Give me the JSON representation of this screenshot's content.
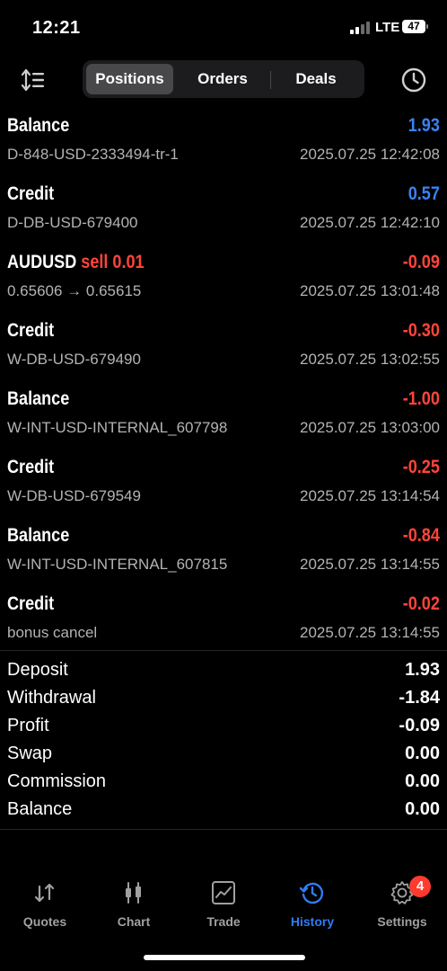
{
  "status_bar": {
    "time": "12:21",
    "network": "LTE",
    "battery": "47"
  },
  "toolbar": {
    "tabs": [
      {
        "label": "Positions"
      },
      {
        "label": "Orders"
      },
      {
        "label": "Deals"
      }
    ],
    "active_tab": "Positions",
    "sort_icon": "sort-icon",
    "history_icon": "clock-icon"
  },
  "colors": {
    "positive": "#3b82f6",
    "negative": "#ff453a",
    "active_tab": "#2f7bf5",
    "badge": "#ff3b30"
  },
  "history": [
    {
      "title": "Balance",
      "amount": "1.93",
      "sign": "positive",
      "subtitle": "D-848-USD-2333494-tr-1",
      "datetime": "2025.07.25 12:42:08"
    },
    {
      "title": "Credit",
      "amount": "0.57",
      "sign": "positive",
      "subtitle": "D-DB-USD-679400",
      "datetime": "2025.07.25 12:42:10"
    },
    {
      "title": "AUDUSD",
      "trade": "sell 0.01",
      "amount": "-0.09",
      "sign": "negative",
      "subtitle": "0.65606 → 0.65615",
      "datetime": "2025.07.25 13:01:48"
    },
    {
      "title": "Credit",
      "amount": "-0.30",
      "sign": "negative",
      "subtitle": "W-DB-USD-679490",
      "datetime": "2025.07.25 13:02:55"
    },
    {
      "title": "Balance",
      "amount": "-1.00",
      "sign": "negative",
      "subtitle": "W-INT-USD-INTERNAL_607798",
      "datetime": "2025.07.25 13:03:00"
    },
    {
      "title": "Credit",
      "amount": "-0.25",
      "sign": "negative",
      "subtitle": "W-DB-USD-679549",
      "datetime": "2025.07.25 13:14:54"
    },
    {
      "title": "Balance",
      "amount": "-0.84",
      "sign": "negative",
      "subtitle": "W-INT-USD-INTERNAL_607815",
      "datetime": "2025.07.25 13:14:55"
    },
    {
      "title": "Credit",
      "amount": "-0.02",
      "sign": "negative",
      "subtitle": "bonus cancel",
      "datetime": "2025.07.25 13:14:55"
    }
  ],
  "summary": [
    {
      "label": "Deposit",
      "value": "1.93"
    },
    {
      "label": "Withdrawal",
      "value": "-1.84"
    },
    {
      "label": "Profit",
      "value": "-0.09"
    },
    {
      "label": "Swap",
      "value": "0.00"
    },
    {
      "label": "Commission",
      "value": "0.00"
    },
    {
      "label": "Balance",
      "value": "0.00"
    }
  ],
  "tabbar": {
    "items": [
      {
        "label": "Quotes",
        "icon": "quotes-icon"
      },
      {
        "label": "Chart",
        "icon": "chart-icon"
      },
      {
        "label": "Trade",
        "icon": "trade-icon"
      },
      {
        "label": "History",
        "icon": "history-icon"
      },
      {
        "label": "Settings",
        "icon": "settings-icon"
      }
    ],
    "active": "History",
    "settings_badge": "4"
  }
}
